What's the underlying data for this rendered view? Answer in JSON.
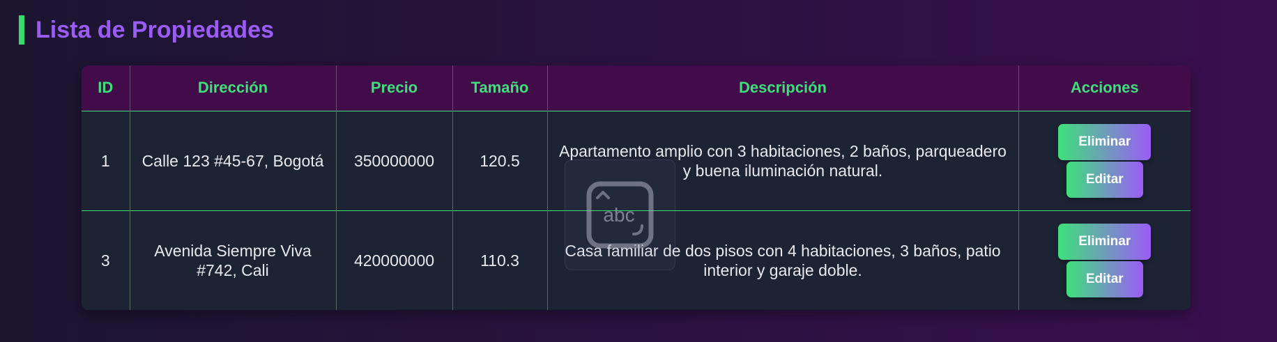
{
  "page": {
    "title": "Lista de Propiedades"
  },
  "table": {
    "headers": [
      "ID",
      "Dirección",
      "Precio",
      "Tamaño",
      "Descripción",
      "Acciones"
    ],
    "rows": [
      {
        "id": "1",
        "address": "Calle 123 #45-67, Bogotá",
        "price": "350000000",
        "size": "120.5",
        "description": "Apartamento amplio con 3 habitaciones, 2 baños, parqueadero y buena iluminación natural."
      },
      {
        "id": "3",
        "address": "Avenida Siempre Viva #742, Cali",
        "price": "420000000",
        "size": "110.3",
        "description": "Casa familiar de dos pisos con 4 habitaciones, 3 baños, patio interior y garaje doble."
      }
    ],
    "actions": {
      "delete_label": "Eliminar",
      "edit_label": "Editar"
    }
  },
  "overlay": {
    "icon": "text-input-keyboard-icon",
    "label": "abc"
  },
  "colors": {
    "accent_green": "#3ee07a",
    "accent_purple": "#9b5cf6",
    "header_bg": "#420c4a",
    "row_bg": "#1c2333"
  }
}
